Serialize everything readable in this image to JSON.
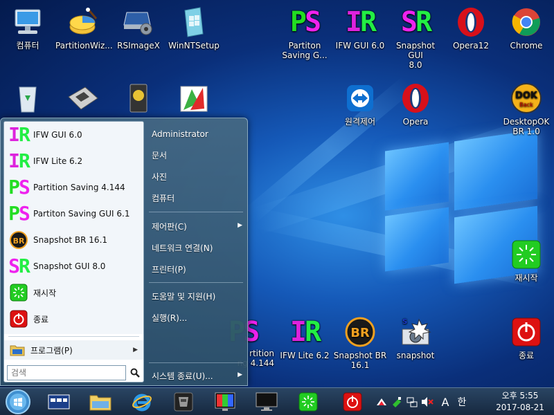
{
  "desktop": {
    "icons": [
      {
        "id": "computer",
        "label": "컴퓨터"
      },
      {
        "id": "partitionwizard",
        "label": "PartitionWiz..."
      },
      {
        "id": "rsimagex",
        "label": "RSImageX"
      },
      {
        "id": "winntsetup",
        "label": "WinNTSetup"
      },
      {
        "id": "partiton-saving-gui",
        "label": "Partiton\nSaving G...",
        "glyph": "PS"
      },
      {
        "id": "ifw-gui",
        "label": "IFW GUI 6.0",
        "glyph": "IR"
      },
      {
        "id": "snapshot-gui",
        "label": "Snapshot GUI\n8.0",
        "glyph": "SR"
      },
      {
        "id": "opera12",
        "label": "Opera12"
      },
      {
        "id": "chrome",
        "label": "Chrome"
      },
      {
        "id": "remote",
        "label": "원격제어"
      },
      {
        "id": "opera",
        "label": "Opera"
      },
      {
        "id": "desktopok",
        "label": "DesktopOK\nBR 1.0",
        "glyph": "DOK"
      },
      {
        "id": "restart",
        "label": "재시작"
      },
      {
        "id": "partition-saving-bottom",
        "label": "rtition\nng 4.144",
        "glyph": "PS"
      },
      {
        "id": "ifw-lite",
        "label": "IFW Lite 6.2",
        "glyph": "IR"
      },
      {
        "id": "snapshot-br",
        "label": "Snapshot BR\n16.1",
        "glyph": "BR"
      },
      {
        "id": "snapshot",
        "label": "snapshot"
      },
      {
        "id": "shutdown",
        "label": "종료"
      }
    ]
  },
  "start_menu": {
    "programs": [
      {
        "label": "IFW GUI 6.0",
        "glyph": "IR"
      },
      {
        "label": "IFW Lite 6.2",
        "glyph": "IR"
      },
      {
        "label": "Partition Saving 4.144",
        "glyph": "PS"
      },
      {
        "label": "Partiton Saving GUI 6.1",
        "glyph": "PS"
      },
      {
        "label": "Snapshot BR 16.1",
        "glyph": "BR"
      },
      {
        "label": "Snapshot GUI 8.0",
        "glyph": "SR"
      },
      {
        "label": "재시작"
      },
      {
        "label": "종료"
      }
    ],
    "all_programs": "프로그램(P)",
    "search_placeholder": "검색",
    "right": {
      "user": "Administrator",
      "documents": "문서",
      "pictures": "사진",
      "computer": "컴퓨터",
      "control_panel": "제어판(C)",
      "network": "네트워크 연결(N)",
      "printers": "프린터(P)",
      "help": "도움말 및 지원(H)",
      "run": "실행(R)...",
      "shutdown": "시스템 종료(U)..."
    }
  },
  "taskbar": {
    "clock_time": "오후 5:55",
    "clock_date": "2017-08-21",
    "ime_mode": "A",
    "ime_lang": "한"
  },
  "colors": {
    "ps_green": "#22dd22",
    "ps_magenta": "#ee22ee",
    "ir_green": "#22ee44",
    "ir_magenta": "#dd22dd",
    "restart_green": "#22cc22",
    "shutdown_red": "#dd1111"
  }
}
